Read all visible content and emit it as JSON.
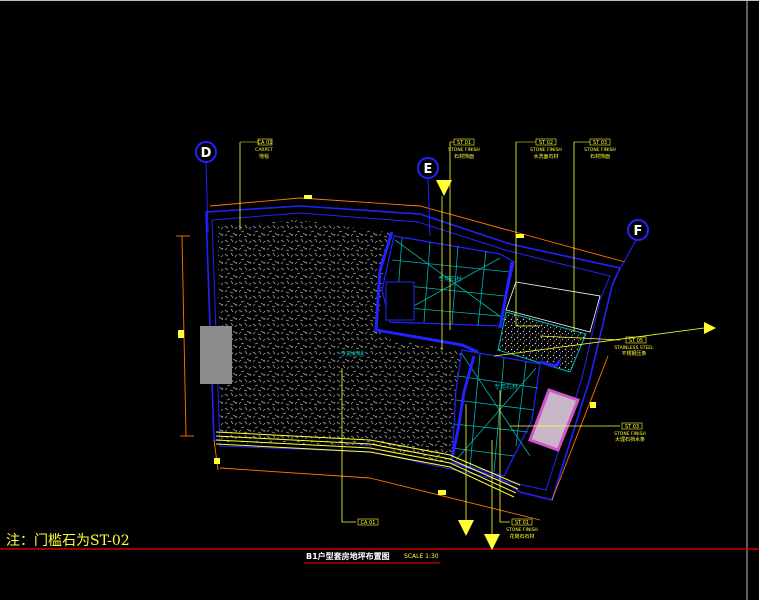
{
  "axes": {
    "D": "D",
    "E": "E",
    "F": "F"
  },
  "callouts": {
    "carpet": {
      "code": "CA 01",
      "en": "CARPET",
      "cn": "地毯"
    },
    "stone_e": {
      "code": "ST 01",
      "en": "STONE FINISH",
      "cn": "石材饰面"
    },
    "stone_g1": {
      "code": "ST 02",
      "en": "STONE FINISH",
      "cn": "水洗面石材"
    },
    "stone_g2": {
      "code": "ST 03",
      "en": "STONE FINISH",
      "cn": "石材饰面"
    },
    "steel": {
      "code": "ST 05",
      "en": "STAINLESS STEEL",
      "cn": "不锈钢压条"
    },
    "marble": {
      "code": "ST 03",
      "en": "STONE FINISH",
      "cn": "大理石挡水条"
    },
    "bottom_left": {
      "code": "CA 01"
    },
    "bottom_right": {
      "code": "ST 01",
      "en": "STONE FINISH",
      "cn": "花岗石石材"
    }
  },
  "room_labels": {
    "carpet_area": "专用地毯",
    "stone_upper": "专用石材",
    "stone_lower": "专用石材"
  },
  "note": "注：门槛石为ST-02",
  "title": {
    "name": "B1户型套房地坪布置图",
    "scale": "SCALE  1:30"
  },
  "colors": {
    "background": "#000000",
    "outline_blue": "#2222ff",
    "leader_yellow": "#ffff33",
    "dimension_orange": "#ff7a00",
    "tile_cyan": "#00b3b3",
    "title_red": "#cc0000",
    "frame_gray": "#ffffff",
    "column_gray": "#8c8c8c",
    "panel_magenta": "#cc55cc"
  }
}
